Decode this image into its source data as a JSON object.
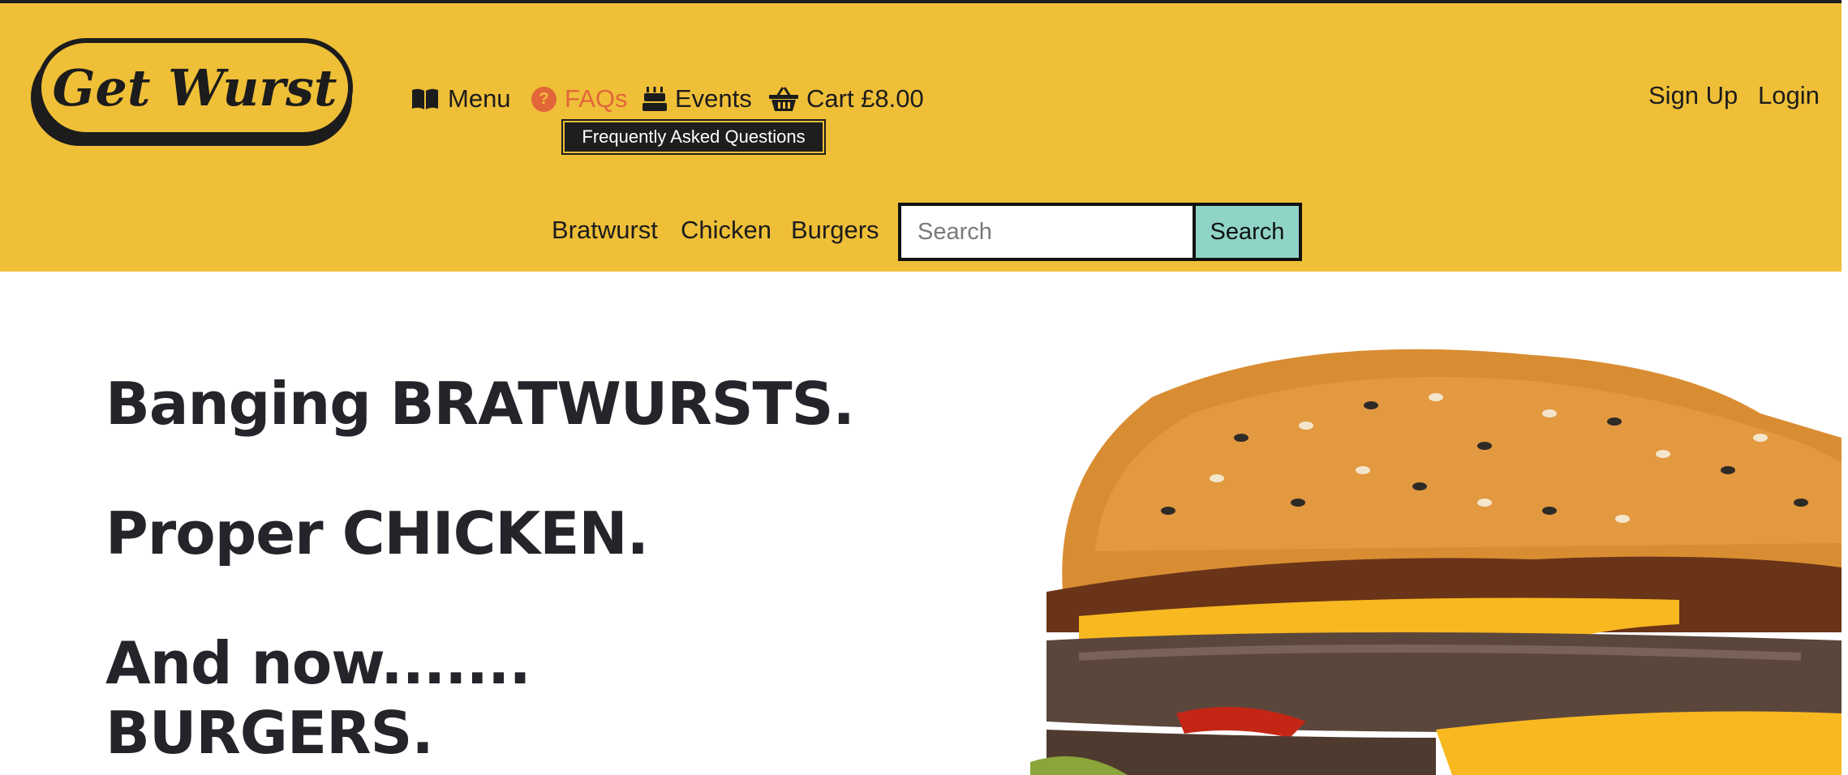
{
  "brand": {
    "logo_text": "Get Wurst"
  },
  "nav": {
    "items": [
      {
        "label": "Menu",
        "icon": "book-icon"
      },
      {
        "label": "FAQs",
        "icon": "question-circle-icon",
        "active": true
      },
      {
        "label": "Events",
        "icon": "cake-icon"
      },
      {
        "label": "Cart £8.00",
        "icon": "basket-icon"
      }
    ],
    "tooltip": "Frequently Asked Questions"
  },
  "auth": {
    "sign_up": "Sign Up",
    "login": "Login"
  },
  "categories": [
    "Bratwurst",
    "Chicken",
    "Burgers"
  ],
  "search": {
    "placeholder": "Search",
    "value": "",
    "button_label": "Search"
  },
  "hero": {
    "line1": "Banging BRATWURSTS.",
    "line2": "Proper CHICKEN.",
    "line3": "And now.......",
    "line4": "BURGERS."
  },
  "colors": {
    "header_bg": "#efbf38",
    "active_nav": "#e2663a",
    "search_button": "#8fd4c6",
    "text_dark": "#23252a"
  }
}
